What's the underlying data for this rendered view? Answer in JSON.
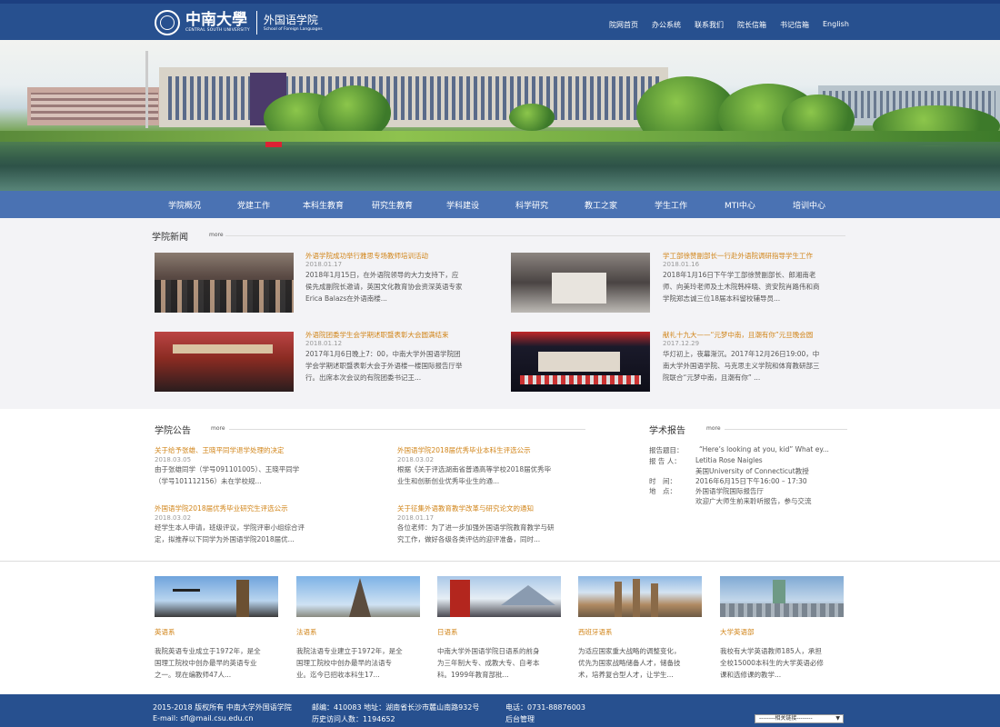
{
  "header": {
    "logo_cn": "中南大學",
    "logo_en": "CENTRAL SOUTH UNIVERSITY",
    "dept_cn": "外国语学院",
    "dept_en": "School of Foreign Languages",
    "nav": [
      "院网首页",
      "办公系统",
      "联系我们",
      "院长信箱",
      "书记信箱",
      "English"
    ]
  },
  "main_nav": [
    "学院概况",
    "党建工作",
    "本科生教育",
    "研究生教育",
    "学科建设",
    "科学研究",
    "教工之家",
    "学生工作",
    "MTI中心",
    "培训中心"
  ],
  "news": {
    "title": "学院新闻",
    "more": "more",
    "items": [
      {
        "title": "外语学院成功举行雅思专场教师培训活动",
        "date": "2018.01.17",
        "text1": "2018年1月15日，在外语院领导的大力支持下，应",
        "text2": "侯先成副院长邀请，英国文化教育协会资深英语专家",
        "text3": "Erica Balazs在外语南楼..."
      },
      {
        "title": "学工部徐赞副部长一行赴外语院调研指导学生工作",
        "date": "2018.01.16",
        "text1": "2018年1月16日下午学工部徐赞副部长、郎湘南老",
        "text2": "师、向美玲老师及土木院韩梓晓、资安院肖路伟和商",
        "text3": "学院郑志诚三位18届本科留校辅导员..."
      },
      {
        "title": "外语院团委学生会学期述职暨表彰大会圆满结束",
        "date": "2018.01.12",
        "text1": "2017年1月6日晚上7：00，中南大学外国语学院团",
        "text2": "学会学期述职暨表彰大会于外语楼一楼国际报告厅举",
        "text3": "行。出席本次会议的有院团委书记王..."
      },
      {
        "title": "献礼十九大——“元梦中南，且潮有你”元旦晚会圆",
        "date": "2017.12.29",
        "text1": "华灯初上，夜幕渐沉。2017年12月26日19:00，中",
        "text2": "南大学外国语学院、马克思主义学院和体育教研部三",
        "text3": "院联合“元梦中南，且潮有你” ..."
      }
    ]
  },
  "notices": {
    "title": "学院公告",
    "more": "more",
    "items": [
      {
        "title": "关于给予张雄、王晓平同学退学处理的决定",
        "date": "2018.03.05",
        "text1": "由于张雄同学（学号091101005）、王晓平同学",
        "text2": "（学号101112156）未在学校规..."
      },
      {
        "title": "外国语学院2018届优秀毕业本科生评选公示",
        "date": "2018.03.02",
        "text1": "根据《关于评选湖南省普通高等学校2018届优秀毕",
        "text2": "业生和创新创业优秀毕业生的通..."
      },
      {
        "title": "外国语学院2018届优秀毕业研究生评选公示",
        "date": "2018.03.02",
        "text1": "经学生本人申请，班级评议，学院评审小组综合评",
        "text2": "定，拟推荐以下同学为外国语学院2018届优..."
      },
      {
        "title": "关于征集外语教育教学改革与研究论文的通知",
        "date": "2018.01.17",
        "text1": "各位老师：为了进一步加强外国语学院教育教学与研",
        "text2": "究工作，做好各级各类评估的迎评准备，同时..."
      }
    ]
  },
  "reports": {
    "title": "学术报告",
    "more": "more",
    "topic_label": "报告题目：",
    "topic": "“Here’s looking at you, kid” What ey...",
    "speaker_label": "报 告 人：",
    "speaker": "Letitia Rose Naigles",
    "speaker_aff": "美国University of Connecticut教授",
    "time_label": "时　间：",
    "time": "2016年6月15日下午16:00 – 17:30",
    "place_label": "地　点：",
    "place": "外国语学院国际报告厅",
    "welcome": "欢迎广大师生前来聆听报告，参与交流"
  },
  "departments": [
    {
      "name": "英语系",
      "text1": "我院英语专业成立于1972年，是全",
      "text2": "国理工院校中创办最早的英语专业",
      "text3": "之一。现在编教师47人..."
    },
    {
      "name": "法语系",
      "text1": "我院法语专业建立于1972年，是全",
      "text2": "国理工院校中创办最早的法语专",
      "text3": "业。迄今已招收本科生17..."
    },
    {
      "name": "日语系",
      "text1": "中南大学外国语学院日语系的前身",
      "text2": "为三年制大专、成教大专、自考本",
      "text3": "科。1999年教育部批..."
    },
    {
      "name": "西班牙语系",
      "text1": "为适应国家重大战略的调整变化，",
      "text2": "优先为国家战略储备人才，储备技",
      "text3": "术，培养复合型人才，让学生..."
    },
    {
      "name": "大学英语部",
      "text1": "我校有大学英语教师185人，承担",
      "text2": "全校15000本科生的大学英语必修",
      "text3": "课和选修课的教学..."
    }
  ],
  "footer": {
    "copyright": "2015-2018 版权所有 中南大学外国语学院",
    "postcode": "邮编：410083 地址：湖南省长沙市麓山南路932号",
    "phone": "电话：0731-88876003",
    "email": "E-mail: sfl@mail.csu.edu.cn",
    "visits": "历史访问人数：1194652",
    "admin": "后台管理",
    "links": "--------相关链接--------"
  },
  "colors": {
    "header": "#27508f",
    "nav": "#4a72b3",
    "accent": "#d18418"
  }
}
